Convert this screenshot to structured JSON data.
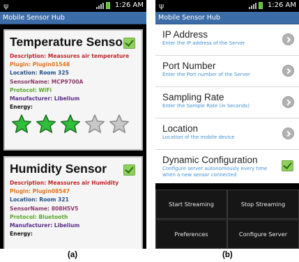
{
  "status": {
    "time": "1:26 AM",
    "usb_icon": "usb-icon",
    "signal_icon": "signal-icon",
    "battery_icon": "battery-icon"
  },
  "app": {
    "title": "Mobile Sensor Hub"
  },
  "panel_a": {
    "caption": "(a)",
    "cards": [
      {
        "title": "Temperature Sensor",
        "checked": true,
        "description": "Description:  Meassures air temperature",
        "plugin": "Plugin: Plugin01548",
        "location": "Location: Room 325",
        "sensor_name": "SensorName: MCP9700A",
        "protocol": "Protocol: WiFi",
        "manufacturer": "Manufacturer: Libelium",
        "energy_label": "Energy:",
        "energy_rating": 3,
        "energy_max": 5
      },
      {
        "title": "Humidity Sensor",
        "checked": true,
        "description": "Description:  Meassures air Humidity",
        "plugin": "Plugin: Plugin08547",
        "location": "Location: Room 321",
        "sensor_name": "SensorName: 808H5V5",
        "protocol": "Protocol: Bluetooth",
        "manufacturer": "Manufacturer: Libelium",
        "energy_label": "Energy:"
      }
    ]
  },
  "panel_b": {
    "caption": "(b)",
    "settings": [
      {
        "title": "IP Address",
        "subtitle": "Enter the IP address of the Server",
        "control": "chevron"
      },
      {
        "title": "Port Number",
        "subtitle": "Enter the Port number of the Server",
        "control": "chevron"
      },
      {
        "title": "Sampling Rate",
        "subtitle": "Enter the Sample Rate (in Seconds)",
        "control": "chevron"
      },
      {
        "title": "Location",
        "subtitle": "Location of the mobile device",
        "control": "chevron"
      },
      {
        "title": "Dynamic Configuration",
        "subtitle": "Configure server autonomously every time when a new sensor connected",
        "control": "checkbox",
        "checked": true
      }
    ],
    "menu": {
      "start_streaming": "Start Streaming",
      "stop_streaming": "Stop Streaming",
      "preferences": "Preferences",
      "configure_server": "Configure Server"
    }
  },
  "colors": {
    "title_bar": "#3d6da8",
    "star_on": "#2fbf3a",
    "star_off": "#c8c8c8",
    "link_blue": "#3f8fd6"
  }
}
